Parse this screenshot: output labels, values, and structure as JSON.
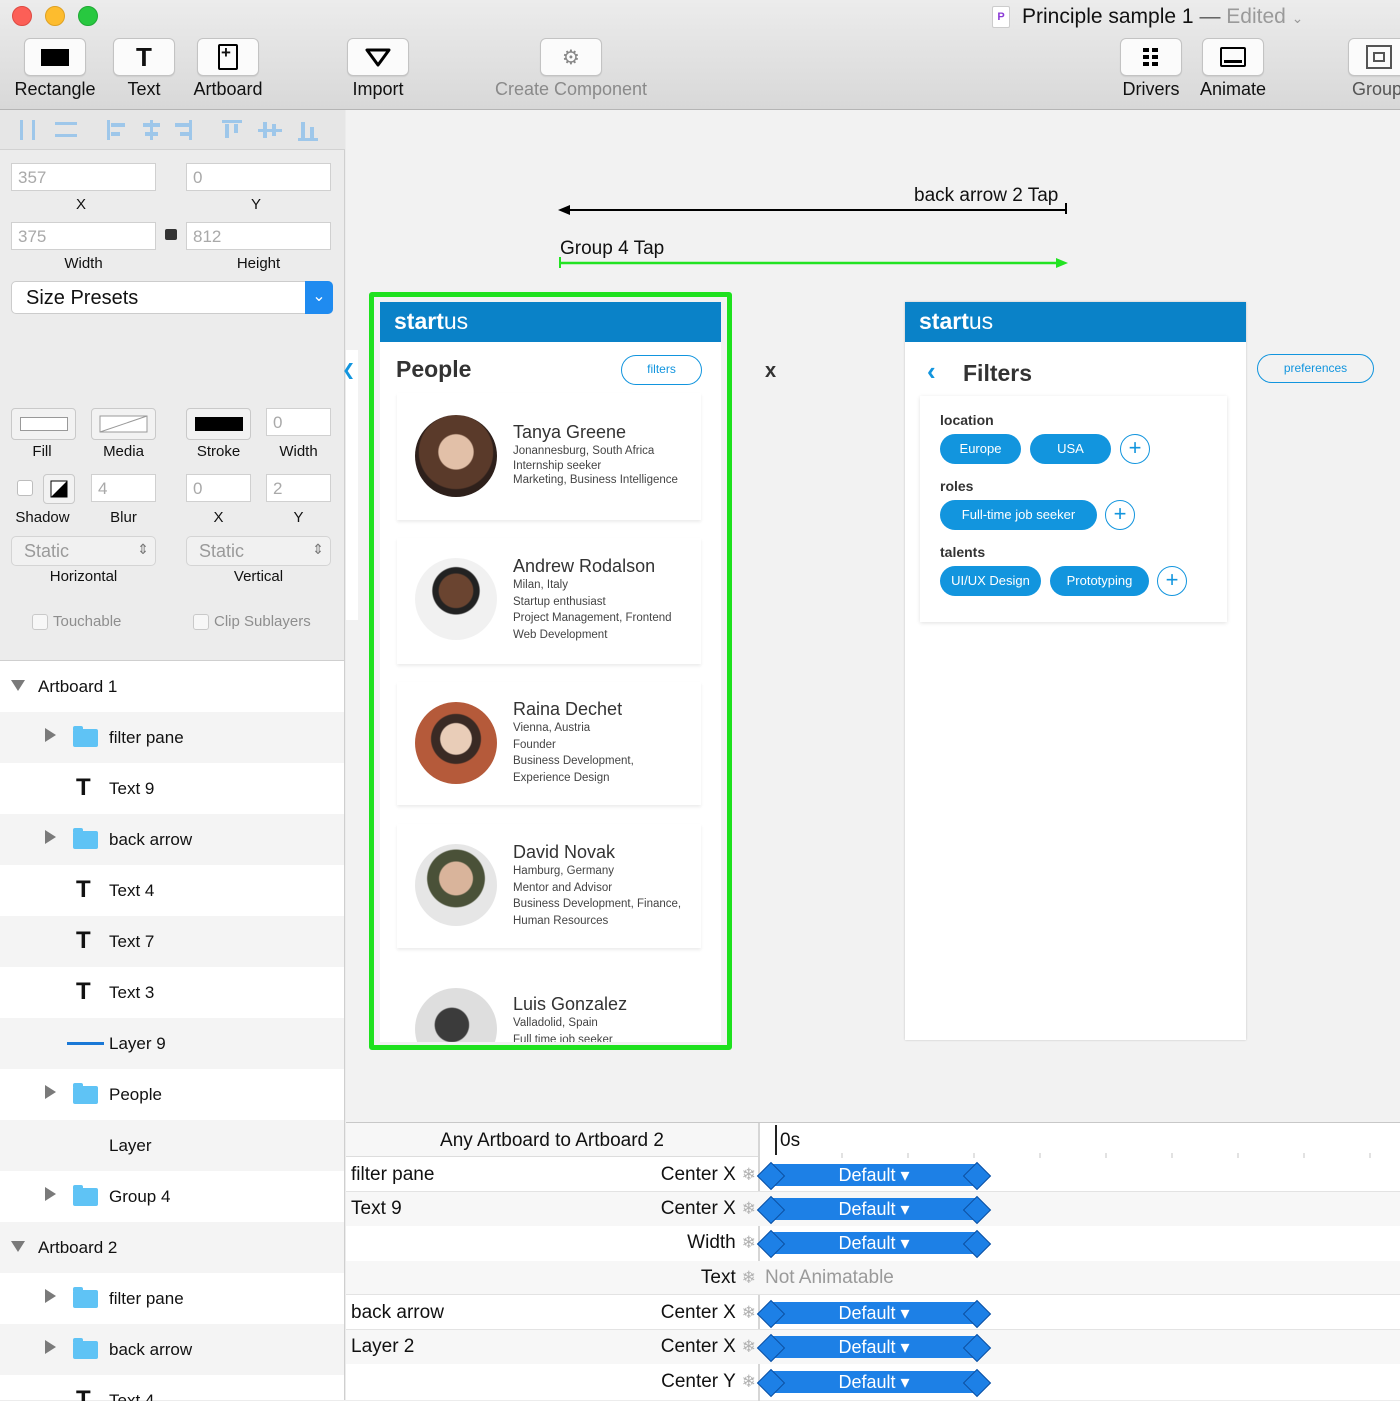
{
  "window": {
    "title": "Principle sample 1",
    "separator": "—",
    "status": "Edited"
  },
  "toolbar": {
    "rectangle": "Rectangle",
    "text": "Text",
    "artboard": "Artboard",
    "import": "Import",
    "create_component": "Create Component",
    "drivers": "Drivers",
    "animate": "Animate",
    "group": "Group"
  },
  "inspector": {
    "x_value": "357",
    "x_label": "X",
    "y_value": "0",
    "y_label": "Y",
    "width_value": "375",
    "width_label": "Width",
    "height_value": "812",
    "height_label": "Height",
    "size_presets": "Size Presets",
    "fill_label": "Fill",
    "media_label": "Media",
    "stroke_label": "Stroke",
    "stroke_width_value": "0",
    "stroke_width_label": "Width",
    "shadow_label": "Shadow",
    "blur_value": "4",
    "blur_label": "Blur",
    "shadow_x_value": "0",
    "shadow_x_label": "X",
    "shadow_y_value": "2",
    "shadow_y_label": "Y",
    "horizontal_value": "Static",
    "horizontal_label": "Horizontal",
    "vertical_value": "Static",
    "vertical_label": "Vertical",
    "touchable_label": "Touchable",
    "clip_label": "Clip Sublayers"
  },
  "layers": [
    {
      "label": "Artboard 1",
      "type": "artboard"
    },
    {
      "label": "filter pane",
      "type": "folder"
    },
    {
      "label": "Text 9",
      "type": "text"
    },
    {
      "label": "back arrow",
      "type": "folder"
    },
    {
      "label": "Text 4",
      "type": "text"
    },
    {
      "label": "Text 7",
      "type": "text"
    },
    {
      "label": "Text 3",
      "type": "text"
    },
    {
      "label": "Layer 9",
      "type": "line"
    },
    {
      "label": "People",
      "type": "folder"
    },
    {
      "label": "Layer",
      "type": "plain"
    },
    {
      "label": "Group 4",
      "type": "folder"
    },
    {
      "label": "Artboard 2",
      "type": "artboard"
    },
    {
      "label": "filter pane",
      "type": "folder"
    },
    {
      "label": "back arrow",
      "type": "folder"
    },
    {
      "label": "Text 4",
      "type": "text"
    }
  ],
  "canvas": {
    "back_arrow_tap": "back arrow 2 Tap",
    "group4_tap": "Group 4 Tap",
    "x_marker": "x",
    "colors": {
      "brand_blue": "#0a82c8",
      "chip_blue": "#1295de",
      "selection_green": "#1ee11e"
    },
    "artboard1": {
      "logo_bold": "start",
      "logo_light": "us",
      "title": "People",
      "filters_button": "filters",
      "people": [
        {
          "name": "Tanya Greene",
          "details": [
            "Jonannesburg, South Africa",
            "Internship seeker",
            "Marketing, Business Intelligence"
          ]
        },
        {
          "name": "Andrew Rodalson",
          "details": [
            "Milan, Italy",
            "Startup enthusiast",
            "Project Management, Frontend",
            "Web Development"
          ]
        },
        {
          "name": "Raina Dechet",
          "details": [
            "Vienna, Austria",
            "Founder",
            "Business Development,",
            "Experience Design"
          ]
        },
        {
          "name": "David Novak",
          "details": [
            "Hamburg, Germany",
            "Mentor and Advisor",
            "Business Development, Finance,",
            "Human Resources"
          ]
        },
        {
          "name": "Luis Gonzalez",
          "details": [
            "Valladolid, Spain",
            "Full time job seeker"
          ]
        }
      ]
    },
    "artboard2": {
      "logo_bold": "start",
      "logo_light": "us",
      "title": "Filters",
      "preferences_button": "preferences",
      "location_label": "location",
      "location_chips": [
        "Europe",
        "USA"
      ],
      "roles_label": "roles",
      "roles_chips": [
        "Full-time job seeker"
      ],
      "talents_label": "talents",
      "talents_chips": [
        "UI/UX Design",
        "Prototyping"
      ],
      "plus": "+"
    }
  },
  "timeline": {
    "header": "Any Artboard to Artboard 2",
    "time": "0s",
    "rows": [
      {
        "layer": "filter pane",
        "property": "Center X",
        "value": "Default ▾"
      },
      {
        "layer": "Text 9",
        "property": "Center X",
        "value": "Default ▾"
      },
      {
        "layer": "",
        "property": "Width",
        "value": "Default ▾"
      },
      {
        "layer": "",
        "property": "Text",
        "value": "Not Animatable"
      },
      {
        "layer": "back arrow",
        "property": "Center X",
        "value": "Default ▾"
      },
      {
        "layer": "Layer 2",
        "property": "Center X",
        "value": "Default ▾"
      },
      {
        "layer": "",
        "property": "Center Y",
        "value": "Default ▾"
      }
    ]
  }
}
